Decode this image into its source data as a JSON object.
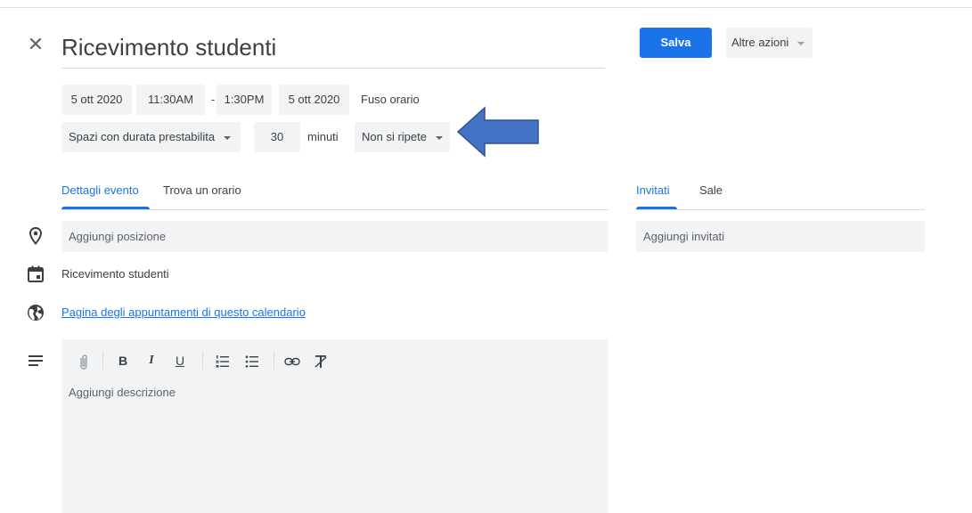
{
  "header": {
    "title": "Ricevimento studenti",
    "save_label": "Salva",
    "more_actions_label": "Altre azioni"
  },
  "datetime": {
    "start_date": "5 ott 2020",
    "start_time": "11:30AM",
    "separator": "-",
    "end_time": "1:30PM",
    "end_date": "5 ott 2020",
    "timezone_label": "Fuso orario"
  },
  "slots": {
    "type_label": "Spazi con durata prestabilita",
    "duration_value": "30",
    "duration_unit": "minuti",
    "repeat_label": "Non si ripete"
  },
  "tabs_left": [
    {
      "label": "Dettagli evento",
      "active": true
    },
    {
      "label": "Trova un orario",
      "active": false
    }
  ],
  "tabs_right": [
    {
      "label": "Invitati",
      "active": true
    },
    {
      "label": "Sale",
      "active": false
    }
  ],
  "location": {
    "placeholder": "Aggiungi posizione"
  },
  "guests": {
    "placeholder": "Aggiungi invitati"
  },
  "calendar": {
    "name": "Ricevimento studenti"
  },
  "booking_link": {
    "label": "Pagina degli appuntamenti di questo calendario"
  },
  "description": {
    "placeholder": "Aggiungi descrizione"
  },
  "toolbar": {
    "bold": "B",
    "italic": "I",
    "underline": "U",
    "icons": [
      "attachment-icon",
      "bold-icon",
      "italic-icon",
      "underline-icon",
      "numbered-list-icon",
      "bulleted-list-icon",
      "link-icon",
      "clear-formatting-icon"
    ]
  },
  "colors": {
    "accent": "#1a73e8",
    "chip_bg": "#f1f3f4",
    "annotation_arrow": "#4472c4"
  }
}
